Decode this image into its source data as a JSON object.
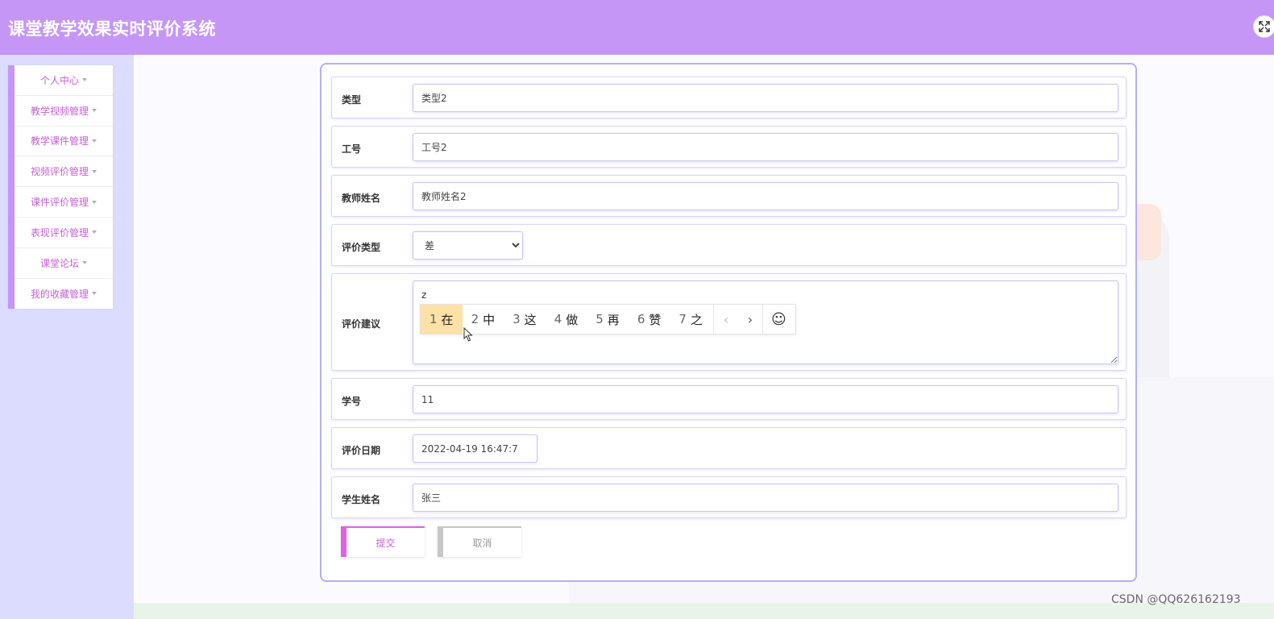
{
  "app": {
    "title": "课堂教学效果实时评价系统"
  },
  "header": {
    "fullscreen_icon": "expand-icon"
  },
  "sidebar": {
    "items": [
      {
        "label": "个人中心"
      },
      {
        "label": "教学视频管理"
      },
      {
        "label": "教学课件管理"
      },
      {
        "label": "视频评价管理"
      },
      {
        "label": "课件评价管理"
      },
      {
        "label": "表现评价管理"
      },
      {
        "label": "课堂论坛"
      },
      {
        "label": "我的收藏管理"
      }
    ]
  },
  "form": {
    "type": {
      "label": "类型",
      "value": "类型2"
    },
    "staff_no": {
      "label": "工号",
      "value": "工号2"
    },
    "teacher_name": {
      "label": "教师姓名",
      "value": "教师姓名2"
    },
    "eval_type": {
      "label": "评价类型",
      "selected": "差"
    },
    "suggestion": {
      "label": "评价建议",
      "value": "z"
    },
    "student_no": {
      "label": "学号",
      "value": "11"
    },
    "eval_date": {
      "label": "评价日期",
      "value": "2022-04-19 16:47:7"
    },
    "student_name": {
      "label": "学生姓名",
      "value": "张三"
    },
    "submit_label": "提交",
    "cancel_label": "取消"
  },
  "ime": {
    "candidates": [
      {
        "num": "1",
        "char": "在"
      },
      {
        "num": "2",
        "char": "中"
      },
      {
        "num": "3",
        "char": "这"
      },
      {
        "num": "4",
        "char": "做"
      },
      {
        "num": "5",
        "char": "再"
      },
      {
        "num": "6",
        "char": "赞"
      },
      {
        "num": "7",
        "char": "之"
      }
    ],
    "prev": "‹",
    "next": "›",
    "emoji": "☺"
  },
  "watermark": "CSDN @QQ626162193",
  "colors": {
    "header": "#c596f6",
    "sidebar_bg": "#dcdcfe",
    "accent": "#e55ee8",
    "menu_text": "#c65fd6",
    "ime_highlight": "#fde1a6"
  }
}
